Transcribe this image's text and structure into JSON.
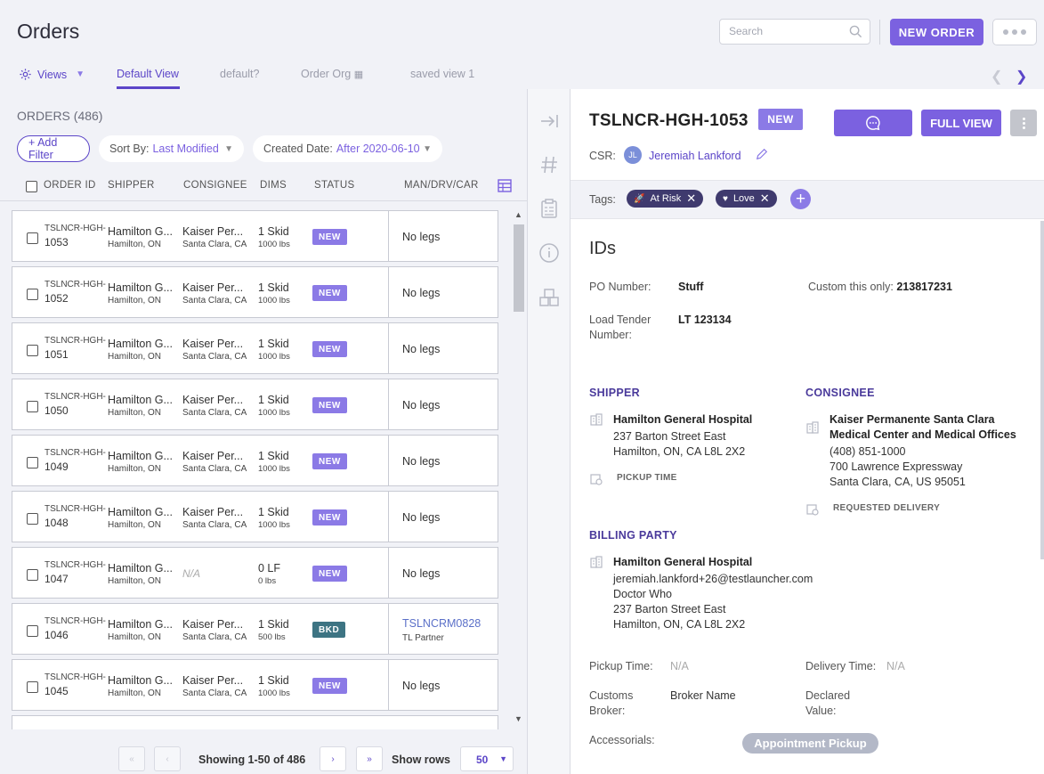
{
  "header": {
    "title": "Orders",
    "search_placeholder": "Search",
    "new_order_label": "NEW ORDER"
  },
  "views": {
    "menu_label": "Views",
    "tabs": [
      {
        "label": "Default View",
        "active": true
      },
      {
        "label": "default?"
      },
      {
        "label": "Order Org"
      },
      {
        "label": "saved view 1"
      }
    ]
  },
  "list": {
    "count_label": "ORDERS (486)",
    "add_filter": "+ Add Filter",
    "sort_label": "Sort By:",
    "sort_value": "Last Modified",
    "date_label": "Created Date:",
    "date_value": "After 2020-06-10",
    "columns": [
      "ORDER ID",
      "SHIPPER",
      "CONSIGNEE",
      "DIMS",
      "STATUS",
      "MAN/DRV/CAR"
    ],
    "rows": [
      {
        "id_prefix": "TSLNCR-HGH-",
        "id_num": "1053",
        "shipper": "Hamilton G...",
        "shipper_loc": "Hamilton, ON",
        "consignee": "Kaiser Per...",
        "consignee_loc": "Santa Clara, CA",
        "dims": "1 Skid",
        "weight": "1000 lbs",
        "status": "NEW",
        "legs": "No legs"
      },
      {
        "id_prefix": "TSLNCR-HGH-",
        "id_num": "1052",
        "shipper": "Hamilton G...",
        "shipper_loc": "Hamilton, ON",
        "consignee": "Kaiser Per...",
        "consignee_loc": "Santa Clara, CA",
        "dims": "1 Skid",
        "weight": "1000 lbs",
        "status": "NEW",
        "legs": "No legs"
      },
      {
        "id_prefix": "TSLNCR-HGH-",
        "id_num": "1051",
        "shipper": "Hamilton G...",
        "shipper_loc": "Hamilton, ON",
        "consignee": "Kaiser Per...",
        "consignee_loc": "Santa Clara, CA",
        "dims": "1 Skid",
        "weight": "1000 lbs",
        "status": "NEW",
        "legs": "No legs"
      },
      {
        "id_prefix": "TSLNCR-HGH-",
        "id_num": "1050",
        "shipper": "Hamilton G...",
        "shipper_loc": "Hamilton, ON",
        "consignee": "Kaiser Per...",
        "consignee_loc": "Santa Clara, CA",
        "dims": "1 Skid",
        "weight": "1000 lbs",
        "status": "NEW",
        "legs": "No legs"
      },
      {
        "id_prefix": "TSLNCR-HGH-",
        "id_num": "1049",
        "shipper": "Hamilton G...",
        "shipper_loc": "Hamilton, ON",
        "consignee": "Kaiser Per...",
        "consignee_loc": "Santa Clara, CA",
        "dims": "1 Skid",
        "weight": "1000 lbs",
        "status": "NEW",
        "legs": "No legs"
      },
      {
        "id_prefix": "TSLNCR-HGH-",
        "id_num": "1048",
        "shipper": "Hamilton G...",
        "shipper_loc": "Hamilton, ON",
        "consignee": "Kaiser Per...",
        "consignee_loc": "Santa Clara, CA",
        "dims": "1 Skid",
        "weight": "1000 lbs",
        "status": "NEW",
        "legs": "No legs"
      },
      {
        "id_prefix": "TSLNCR-HGH-",
        "id_num": "1047",
        "shipper": "Hamilton G...",
        "shipper_loc": "Hamilton, ON",
        "consignee": "N/A",
        "consignee_loc": "",
        "dims": "0 LF",
        "weight": "0 lbs",
        "status": "NEW",
        "legs": "No legs"
      },
      {
        "id_prefix": "TSLNCR-HGH-",
        "id_num": "1046",
        "shipper": "Hamilton G...",
        "shipper_loc": "Hamilton, ON",
        "consignee": "Kaiser Per...",
        "consignee_loc": "Santa Clara, CA",
        "dims": "1 Skid",
        "weight": "500 lbs",
        "status": "BKD",
        "legs": "TSLNCRM0828",
        "legs_sub": "TL Partner"
      },
      {
        "id_prefix": "TSLNCR-HGH-",
        "id_num": "1045",
        "shipper": "Hamilton G...",
        "shipper_loc": "Hamilton, ON",
        "consignee": "Kaiser Per...",
        "consignee_loc": "Santa Clara, CA",
        "dims": "1 Skid",
        "weight": "1000 lbs",
        "status": "NEW",
        "legs": "No legs"
      }
    ],
    "pagination": {
      "showing": "Showing 1-50 of 486",
      "show_rows_label": "Show rows",
      "rows_value": "50"
    }
  },
  "detail": {
    "order_id": "TSLNCR-HGH-1053",
    "status": "NEW",
    "full_view_label": "FULL VIEW",
    "csr_label": "CSR:",
    "csr_initials": "JL",
    "csr_name": "Jeremiah Lankford",
    "tags_label": "Tags:",
    "tags": [
      "At Risk",
      "Love"
    ],
    "ids_title": "IDs",
    "po_label": "PO Number:",
    "po_value": "Stuff",
    "custom_label": "Custom this only:",
    "custom_value": "213817231",
    "load_tender_label_1": "Load Tender",
    "load_tender_label_2": "Number:",
    "load_tender_value": "LT 123134",
    "shipper_title": "SHIPPER",
    "shipper_name": "Hamilton General Hospital",
    "shipper_addr1": "237 Barton Street East",
    "shipper_addr2": "Hamilton, ON, CA L8L 2X2",
    "pickup_time_cap": "PICKUP TIME",
    "consignee_title": "CONSIGNEE",
    "consignee_name_1": "Kaiser Permanente Santa Clara",
    "consignee_name_2": "Medical Center and Medical Offices",
    "consignee_phone": "(408) 851-1000",
    "consignee_addr1": "700 Lawrence Expressway",
    "consignee_addr2": "Santa Clara, CA, US 95051",
    "requested_delivery_cap": "REQUESTED DELIVERY",
    "billing_title": "BILLING PARTY",
    "billing_name": "Hamilton General Hospital",
    "billing_email": "jeremiah.lankford+26@testlauncher.com",
    "billing_contact": "Doctor Who",
    "billing_addr1": "237 Barton Street East",
    "billing_addr2": "Hamilton, ON, CA L8L 2X2",
    "pickup_time_label": "Pickup Time:",
    "pickup_time_value": "N/A",
    "delivery_time_label": "Delivery Time:",
    "delivery_time_value": "N/A",
    "customs_label_1": "Customs",
    "customs_label_2": "Broker:",
    "customs_value": "Broker Name",
    "declared_label_1": "Declared",
    "declared_label_2": "Value:",
    "accessorials_label": "Accessorials:",
    "accessorial_pill": "Appointment Pickup"
  },
  "colors": {
    "accent": "#7b61e0",
    "accent_dark": "#5b45c8",
    "bkd": "#3d7483",
    "tag": "#3f3a6e"
  }
}
